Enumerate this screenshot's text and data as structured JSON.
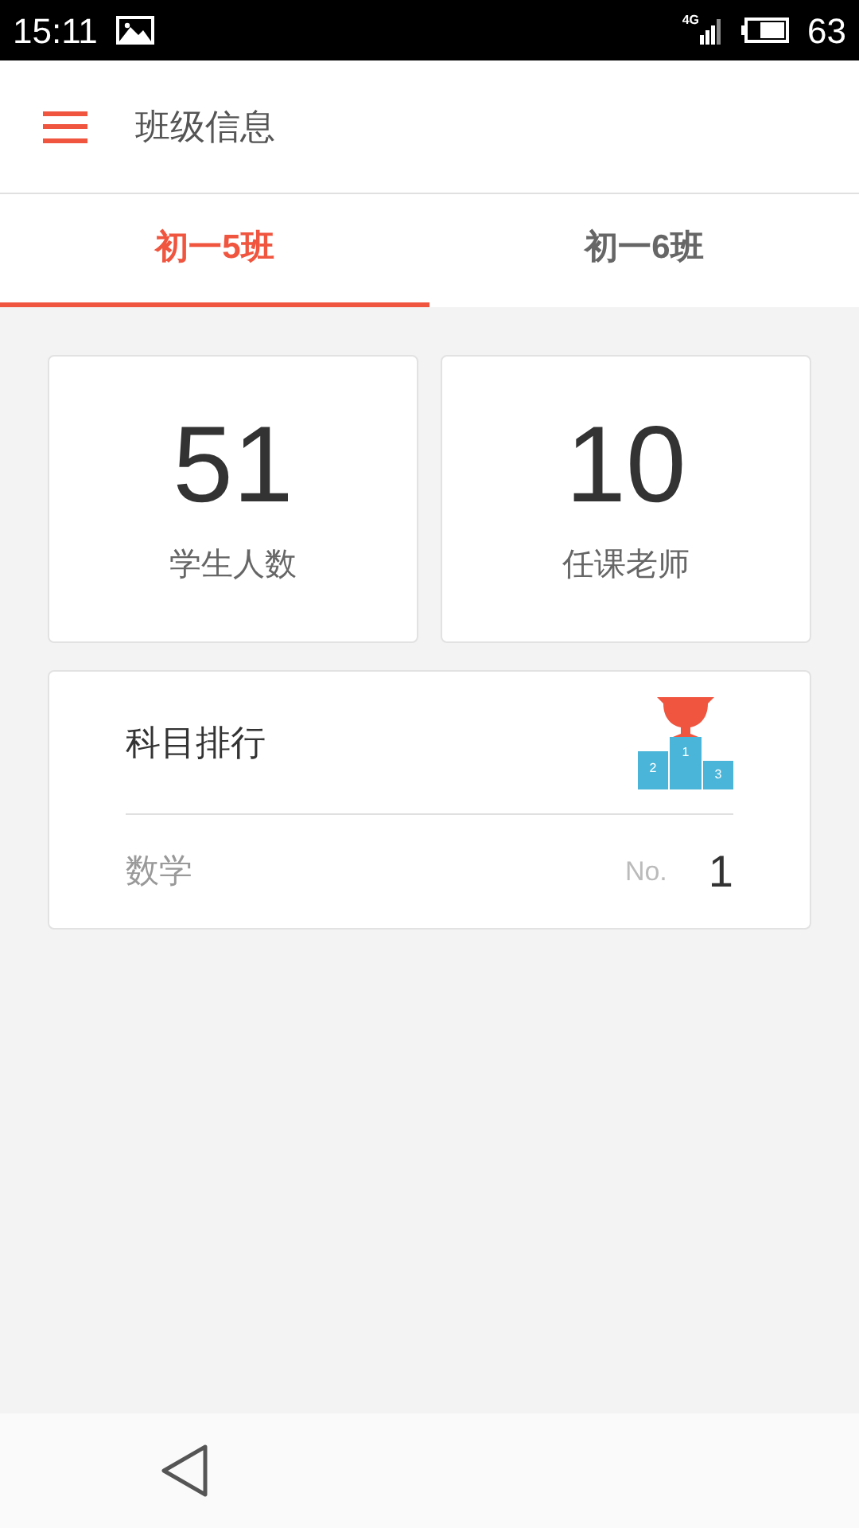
{
  "status_bar": {
    "time": "15:11",
    "network": "4G",
    "battery": "63"
  },
  "app_bar": {
    "title": "班级信息"
  },
  "tabs": [
    {
      "label": "初一5班",
      "selected": true
    },
    {
      "label": "初一6班",
      "selected": false
    }
  ],
  "stats": [
    {
      "value": "51",
      "label": "学生人数"
    },
    {
      "value": "10",
      "label": "任课老师"
    }
  ],
  "ranking": {
    "title": "科目排行",
    "podium_labels": [
      "2",
      "1",
      "3"
    ],
    "rows": [
      {
        "subject": "数学",
        "prefix": "No.",
        "rank": "1"
      }
    ]
  }
}
